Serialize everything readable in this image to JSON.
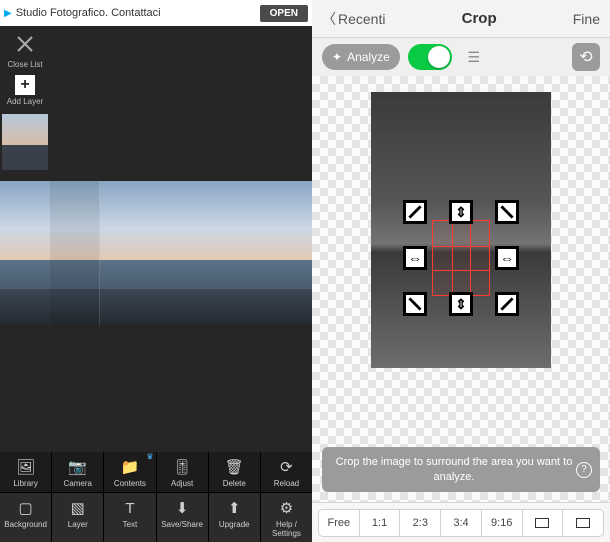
{
  "left": {
    "ad": {
      "text": "Studio Fotografico. Contattaci",
      "cta": "OPEN"
    },
    "sidebar": {
      "close_label": "Close List",
      "add_label": "Add Layer"
    },
    "toolbar_row1": [
      {
        "icon": "image-icon",
        "label": "Library"
      },
      {
        "icon": "camera-icon",
        "label": "Camera"
      },
      {
        "icon": "folder-icon",
        "label": "Contents",
        "badge": "crown"
      },
      {
        "icon": "sliders-icon",
        "label": "Adjust"
      },
      {
        "icon": "trash-icon",
        "label": "Delete"
      },
      {
        "icon": "reload-icon",
        "label": "Reload"
      }
    ],
    "toolbar_row2": [
      {
        "icon": "square-icon",
        "label": "Background"
      },
      {
        "icon": "layers-icon",
        "label": "Layer"
      },
      {
        "icon": "text-icon",
        "label": "Text"
      },
      {
        "icon": "download-icon",
        "label": "Save/Share"
      },
      {
        "icon": "up-circle-icon",
        "label": "Upgrade"
      },
      {
        "icon": "gear-icon",
        "label": "Help / Settings"
      }
    ]
  },
  "right": {
    "nav": {
      "back": "Recenti",
      "title": "Crop",
      "done": "Fine"
    },
    "analyze": {
      "label": "Analyze",
      "toggle_on": true
    },
    "hint": "Crop the image to surround the area you want to analyze.",
    "ratios": [
      "Free",
      "1:1",
      "2:3",
      "3:4",
      "9:16"
    ],
    "orientation_icons": [
      "landscape-icon",
      "portrait-icon"
    ]
  }
}
